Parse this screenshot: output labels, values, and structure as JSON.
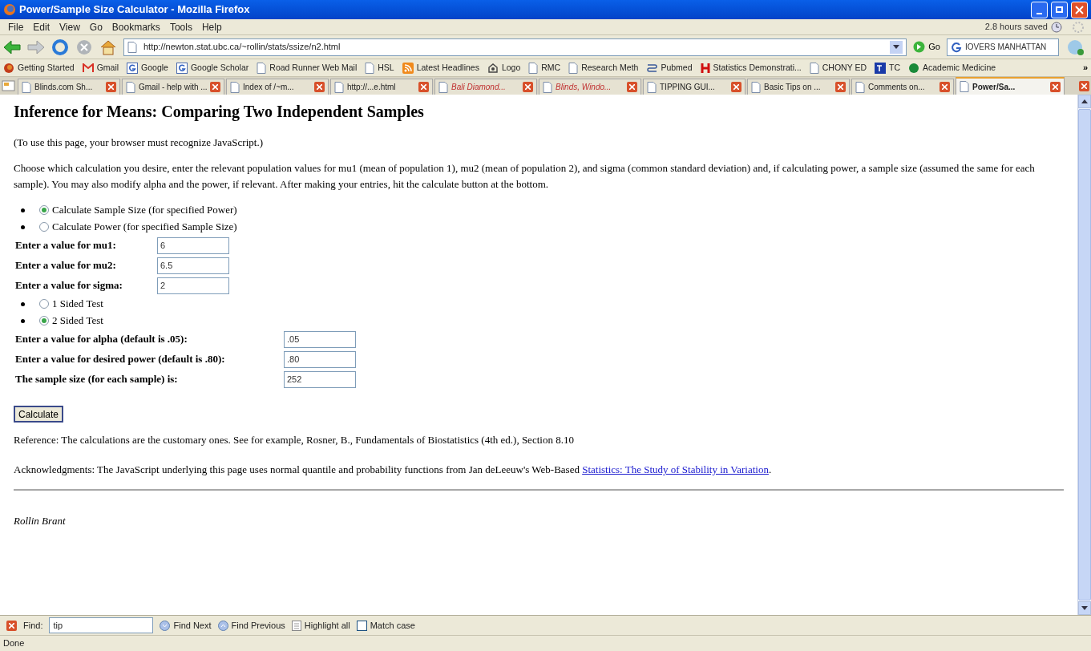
{
  "window": {
    "title": "Power/Sample Size Calculator - Mozilla Firefox"
  },
  "menu": [
    "File",
    "Edit",
    "View",
    "Go",
    "Bookmarks",
    "Tools",
    "Help"
  ],
  "hours_saved": "2.8 hours saved",
  "address": {
    "value": "http://newton.stat.ubc.ca/~rollin/stats/ssize/n2.html"
  },
  "go": "Go",
  "search": {
    "value": "IOVERS MANHATTAN"
  },
  "bookmarks": [
    {
      "label": "Getting Started",
      "kind": "firefox"
    },
    {
      "label": "Gmail",
      "kind": "gmail"
    },
    {
      "label": "Google",
      "kind": "google"
    },
    {
      "label": "Google Scholar",
      "kind": "google"
    },
    {
      "label": "Road Runner Web Mail",
      "kind": "page"
    },
    {
      "label": "HSL",
      "kind": "page"
    },
    {
      "label": "Latest Headlines",
      "kind": "rss"
    },
    {
      "label": "Logo",
      "kind": "logo"
    },
    {
      "label": "RMC",
      "kind": "page"
    },
    {
      "label": "Research Meth",
      "kind": "page"
    },
    {
      "label": "Pubmed",
      "kind": "pubmed"
    },
    {
      "label": "Statistics Demonstrati...",
      "kind": "h"
    },
    {
      "label": "CHONY ED",
      "kind": "page"
    },
    {
      "label": "TC",
      "kind": "tc"
    },
    {
      "label": "Academic Medicine",
      "kind": "dot"
    }
  ],
  "bookmarks_more": "»",
  "tabs": [
    {
      "label": "Blinds.com Sh...",
      "selected": false,
      "italic": false
    },
    {
      "label": "Gmail - help with ...",
      "selected": false,
      "italic": false
    },
    {
      "label": "Index of /~m...",
      "selected": false,
      "italic": false
    },
    {
      "label": "http://...e.html",
      "selected": false,
      "italic": false
    },
    {
      "label": "Bali Diamond...",
      "selected": false,
      "italic": true
    },
    {
      "label": "Blinds, Windo...",
      "selected": false,
      "italic": true
    },
    {
      "label": "TIPPING GUI...",
      "selected": false,
      "italic": false
    },
    {
      "label": "Basic Tips on ...",
      "selected": false,
      "italic": false
    },
    {
      "label": "Comments on...",
      "selected": false,
      "italic": false
    },
    {
      "label": "Power/Sa...",
      "selected": true,
      "italic": false
    }
  ],
  "page": {
    "heading": "Inference for Means: Comparing Two Independent Samples",
    "note": "(To use this page, your browser must recognize JavaScript.)",
    "intro": "Choose which calculation you desire, enter the relevant population values for mu1 (mean of population 1), mu2 (mean of population 2), and sigma (common standard deviation) and, if calculating power, a sample size (assumed the same for each sample). You may also modify alpha and the power, if relevant. After making your entries, hit the calculate button at the bottom.",
    "form": [
      {
        "kind": "radio",
        "label": "Calculate Sample Size (for specified Power)",
        "selected": true
      },
      {
        "kind": "radio",
        "label": "Calculate Power (for specified Sample Size)",
        "selected": false
      },
      {
        "kind": "field",
        "label": "Enter a value for mu1:",
        "value": "6"
      },
      {
        "kind": "field",
        "label": "Enter a value for mu2:",
        "value": "6.5"
      },
      {
        "kind": "field",
        "label": "Enter a value for sigma:",
        "value": "2"
      },
      {
        "kind": "radio",
        "label": "1 Sided Test",
        "selected": false
      },
      {
        "kind": "radio",
        "label": "2 Sided Test",
        "selected": true
      },
      {
        "kind": "widefield",
        "label": "Enter a value for alpha (default is .05):",
        "value": ".05"
      },
      {
        "kind": "widefield",
        "label": "Enter a value for desired power (default is .80):",
        "value": ".80"
      },
      {
        "kind": "widefield",
        "label": "The sample size (for each sample) is:",
        "value": "252"
      }
    ],
    "button": "Calculate",
    "reference": "Reference: The calculations are the customary ones. See for example, Rosner, B., Fundamentals of Biostatistics (4th ed.), Section 8.10",
    "acknowledgments": "Acknowledgments: The JavaScript underlying this page uses normal quantile and probability functions from Jan deLeeuw's Web-Based",
    "link": "Statistics: The Study of Stability in Variation",
    "link_after": ".",
    "author": "Rollin Brant"
  },
  "find_bar": {
    "label": "Find:",
    "value": "tip",
    "find_next": "Find Next",
    "find_previous": "Find Previous",
    "highlight": "Highlight all",
    "match_case": {
      "label": "Match case",
      "checked": false
    }
  },
  "status_bar": "Done"
}
